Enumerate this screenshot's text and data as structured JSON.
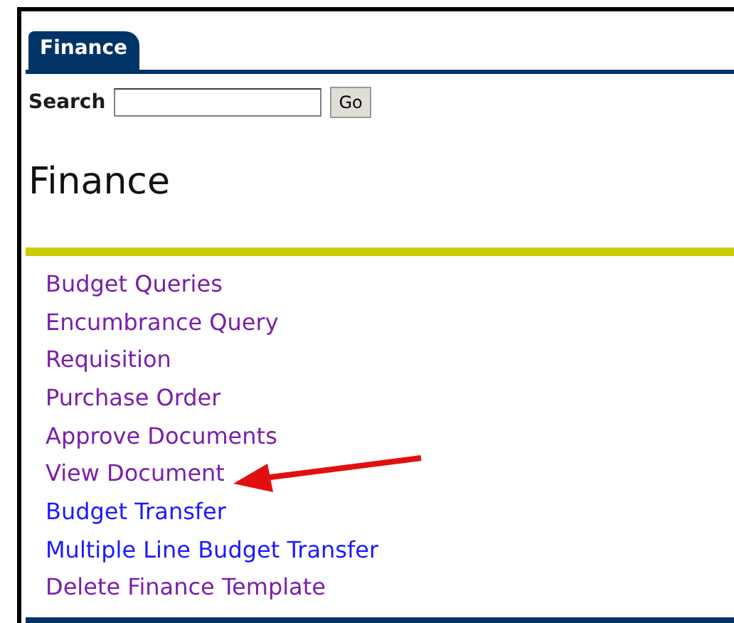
{
  "tabs": [
    {
      "label": "Finance",
      "selected": true
    }
  ],
  "search": {
    "label": "Search",
    "button": "Go"
  },
  "heading": "Finance",
  "links": [
    {
      "label": "Budget Queries",
      "visited": true,
      "highlighted": false
    },
    {
      "label": "Encumbrance Query",
      "visited": true,
      "highlighted": false
    },
    {
      "label": "Requisition",
      "visited": true,
      "highlighted": false
    },
    {
      "label": "Purchase Order",
      "visited": true,
      "highlighted": false
    },
    {
      "label": "Approve Documents",
      "visited": true,
      "highlighted": false
    },
    {
      "label": "View Document",
      "visited": true,
      "highlighted": true
    },
    {
      "label": "Budget Transfer",
      "visited": false,
      "highlighted": false
    },
    {
      "label": "Multiple Line Budget Transfer",
      "visited": false,
      "highlighted": false
    },
    {
      "label": "Delete Finance Template",
      "visited": true,
      "highlighted": false
    }
  ]
}
